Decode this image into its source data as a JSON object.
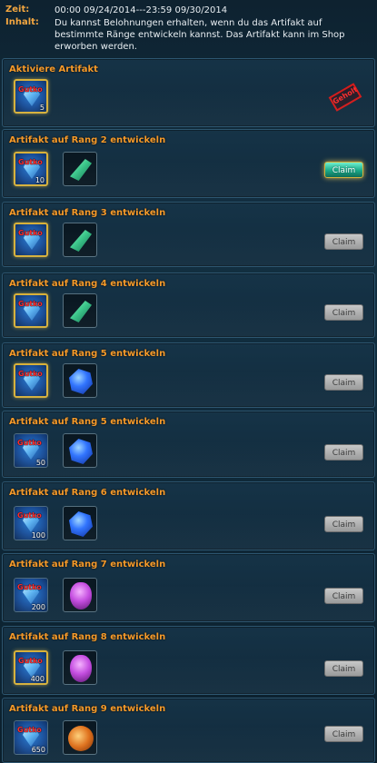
{
  "header": {
    "zeit_label": "Zeit:",
    "zeit_value": "00:00 09/24/2014---23:59 09/30/2014",
    "inhalt_label": "Inhalt:",
    "inhalt_value": "Du kannst Belohnungen erhalten, wenn du das Artifakt auf bestimmte Ränge entwickeln kannst. Das Artifakt kann im Shop erworben werden."
  },
  "gem_label": "Gutko",
  "claim_label": "Claim",
  "stamp_label": "Geholt",
  "rows": [
    {
      "title": "Aktiviere Artifakt",
      "qty": "5",
      "reward": null,
      "state": "claimed"
    },
    {
      "title": "Artifakt auf Rang 2 entwickeln",
      "qty": "10",
      "reward": "green-crystal",
      "state": "active"
    },
    {
      "title": "Artifakt auf Rang 3 entwickeln",
      "qty": "",
      "reward": "green-crystal",
      "state": "disabled"
    },
    {
      "title": "Artifakt auf Rang 4 entwickeln",
      "qty": "",
      "reward": "green-crystal",
      "state": "disabled"
    },
    {
      "title": "Artifakt auf Rang 5 entwickeln",
      "qty": "",
      "reward": "blue-gem",
      "state": "disabled"
    },
    {
      "title": "Artifakt auf Rang 5 entwickeln",
      "qty": "50",
      "reward": "blue-gem",
      "state": "disabled"
    },
    {
      "title": "Artifakt auf Rang 6 entwickeln",
      "qty": "100",
      "reward": "blue-gem",
      "state": "disabled"
    },
    {
      "title": "Artifakt auf Rang 7 entwickeln",
      "qty": "200",
      "reward": "purple-egg",
      "state": "disabled"
    },
    {
      "title": "Artifakt auf Rang 8 entwickeln",
      "qty": "400",
      "reward": "purple-egg",
      "state": "disabled"
    },
    {
      "title": "Artifakt auf Rang 9 entwickeln",
      "qty": "650",
      "reward": "orange-orb",
      "state": "disabled"
    }
  ]
}
